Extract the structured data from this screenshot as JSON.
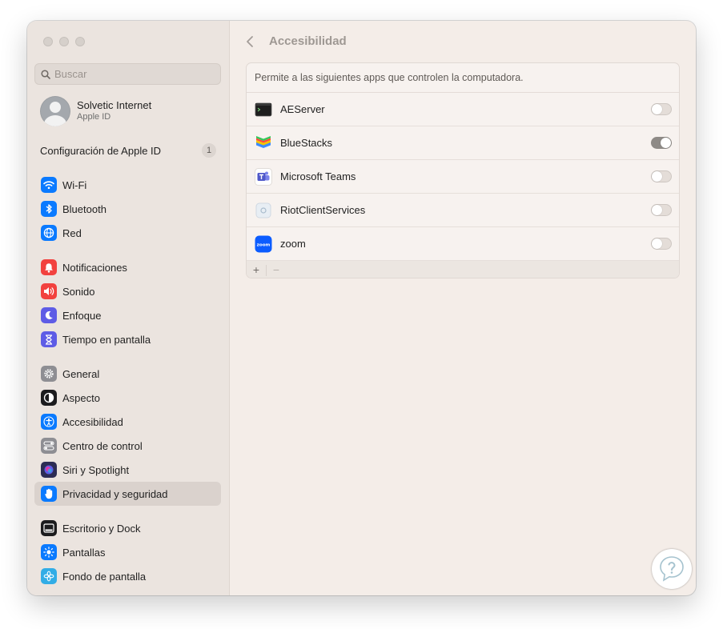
{
  "window": {
    "title": "Accesibilidad"
  },
  "search": {
    "placeholder": "Buscar",
    "value": ""
  },
  "profile": {
    "name": "Solvetic Internet",
    "subtitle": "Apple ID"
  },
  "apple_id_row": {
    "label": "Configuración de Apple ID",
    "badge": "1"
  },
  "sidebar": {
    "items": [
      {
        "label": "Wi-Fi",
        "icon": "wifi-icon",
        "color": "#0a7aff"
      },
      {
        "label": "Bluetooth",
        "icon": "bluetooth-icon",
        "color": "#0a7aff"
      },
      {
        "label": "Red",
        "icon": "globe-icon",
        "color": "#0a7aff"
      },
      {
        "label": "Notificaciones",
        "icon": "bell-icon",
        "color": "#f2413e"
      },
      {
        "label": "Sonido",
        "icon": "speaker-icon",
        "color": "#f2413e"
      },
      {
        "label": "Enfoque",
        "icon": "moon-icon",
        "color": "#5e5ce6"
      },
      {
        "label": "Tiempo en pantalla",
        "icon": "hourglass-icon",
        "color": "#5e5ce6"
      },
      {
        "label": "General",
        "icon": "gear-icon",
        "color": "#8e8e93"
      },
      {
        "label": "Aspecto",
        "icon": "appearance-icon",
        "color": "#1c1c1e"
      },
      {
        "label": "Accesibilidad",
        "icon": "accessibility-icon",
        "color": "#0a7aff"
      },
      {
        "label": "Centro de control",
        "icon": "switches-icon",
        "color": "#8e8e93"
      },
      {
        "label": "Siri y Spotlight",
        "icon": "siri-icon",
        "color": "#2c2c54"
      },
      {
        "label": "Privacidad y seguridad",
        "icon": "hand-icon",
        "color": "#0a7aff",
        "selected": true
      },
      {
        "label": "Escritorio y Dock",
        "icon": "dock-icon",
        "color": "#1c1c1e"
      },
      {
        "label": "Pantallas",
        "icon": "sun-icon",
        "color": "#0a7aff"
      },
      {
        "label": "Fondo de pantalla",
        "icon": "flower-icon",
        "color": "#32ade6"
      }
    ]
  },
  "main": {
    "title": "Accesibilidad",
    "description": "Permite a las siguientes apps que controlen la computadora.",
    "apps": [
      {
        "name": "AEServer",
        "icon": "terminal-icon",
        "enabled": false
      },
      {
        "name": "BlueStacks",
        "icon": "bluestacks-icon",
        "enabled": true
      },
      {
        "name": "Microsoft Teams",
        "icon": "teams-icon",
        "enabled": false
      },
      {
        "name": "RiotClientServices",
        "icon": "generic-app-icon",
        "enabled": false
      },
      {
        "name": "zoom",
        "icon": "zoom-icon",
        "enabled": false
      }
    ],
    "footer": {
      "add": "+",
      "remove": "−"
    }
  },
  "colors": {
    "accent": "#0a7aff",
    "toggle_on": "#8e8a86",
    "window_bg": "#f4ede8",
    "sidebar_bg": "#ebe4df"
  }
}
